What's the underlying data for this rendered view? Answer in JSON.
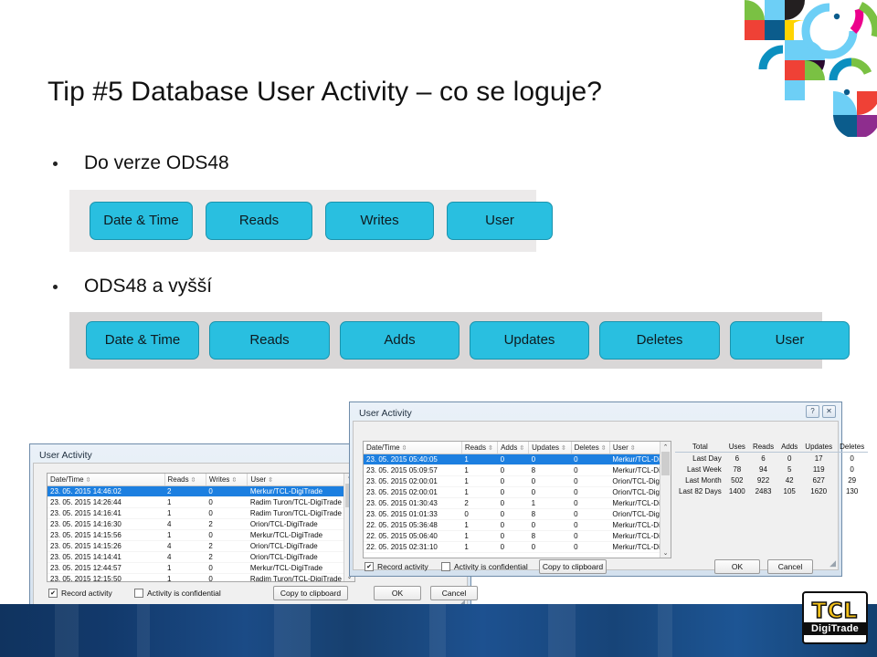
{
  "slide": {
    "title": "Tip #5 Database User Activity – co se loguje?",
    "bullets": [
      {
        "text": "Do verze ODS48"
      },
      {
        "text": "ODS48 a vyšší"
      }
    ]
  },
  "colors": {
    "cyan_button": "#29bfe0",
    "cyan_button_border": "#1a93ad",
    "band_light": "#eceaea",
    "band_dark": "#d9d7d7",
    "selection_blue": "#1c7fe0",
    "footer_blue": "#17406f",
    "logo_yellow": "#f5c21b"
  },
  "band_ods48": {
    "buttons": [
      "Date & Time",
      "Reads",
      "Writes",
      "User"
    ]
  },
  "band_ods48_plus": {
    "buttons": [
      "Date & Time",
      "Reads",
      "Adds",
      "Updates",
      "Deletes",
      "User"
    ]
  },
  "back_window": {
    "title": "User Activity",
    "columns": [
      "Date/Time",
      "Reads",
      "Writes",
      "User"
    ],
    "sort_glyph": "⇳",
    "rows": [
      {
        "datetime": "23. 05. 2015 14:46:02",
        "reads": "2",
        "writes": "0",
        "user": "Merkur/TCL-DigiTrade",
        "selected": true
      },
      {
        "datetime": "23. 05. 2015 14:26:44",
        "reads": "1",
        "writes": "0",
        "user": "Radim Turon/TCL-DigiTrade",
        "selected": false
      },
      {
        "datetime": "23. 05. 2015 14:16:41",
        "reads": "1",
        "writes": "0",
        "user": "Radim Turon/TCL-DigiTrade",
        "selected": false
      },
      {
        "datetime": "23. 05. 2015 14:16:30",
        "reads": "4",
        "writes": "2",
        "user": "Orion/TCL-DigiTrade",
        "selected": false
      },
      {
        "datetime": "23. 05. 2015 14:15:56",
        "reads": "1",
        "writes": "0",
        "user": "Merkur/TCL-DigiTrade",
        "selected": false
      },
      {
        "datetime": "23. 05. 2015 14:15:26",
        "reads": "4",
        "writes": "2",
        "user": "Orion/TCL-DigiTrade",
        "selected": false
      },
      {
        "datetime": "23. 05. 2015 14:14:41",
        "reads": "4",
        "writes": "2",
        "user": "Orion/TCL-DigiTrade",
        "selected": false
      },
      {
        "datetime": "23. 05. 2015 12:44:57",
        "reads": "1",
        "writes": "0",
        "user": "Merkur/TCL-DigiTrade",
        "selected": false
      },
      {
        "datetime": "23. 05. 2015 12:15:50",
        "reads": "1",
        "writes": "0",
        "user": "Radim Turon/TCL-DigiTrade",
        "selected": false
      }
    ],
    "footer": {
      "record_activity_label": "Record activity",
      "record_activity_checked": true,
      "record_activity_mark": "✔",
      "confidential_label": "Activity is confidential",
      "confidential_checked": false,
      "copy_label": "Copy to clipboard",
      "ok_label": "OK",
      "cancel_label": "Cancel"
    },
    "scroll_up_glyph": "⌃",
    "scroll_down_glyph": "⌄"
  },
  "front_window": {
    "title": "User Activity",
    "caption_help": "?",
    "caption_close": "✕",
    "columns": [
      "Date/Time",
      "Reads",
      "Adds",
      "Updates",
      "Deletes",
      "User"
    ],
    "sort_glyph": "⇳",
    "rows": [
      {
        "datetime": "23. 05. 2015 05:40:05",
        "reads": "1",
        "adds": "0",
        "updates": "0",
        "deletes": "0",
        "user": "Merkur/TCL-DigiTrade",
        "selected": true
      },
      {
        "datetime": "23. 05. 2015 05:09:57",
        "reads": "1",
        "adds": "0",
        "updates": "8",
        "deletes": "0",
        "user": "Merkur/TCL-DigiTrade",
        "selected": false
      },
      {
        "datetime": "23. 05. 2015 02:00:01",
        "reads": "1",
        "adds": "0",
        "updates": "0",
        "deletes": "0",
        "user": "Orion/TCL-DigiTrade",
        "selected": false
      },
      {
        "datetime": "23. 05. 2015 02:00:01",
        "reads": "1",
        "adds": "0",
        "updates": "0",
        "deletes": "0",
        "user": "Orion/TCL-DigiTrade",
        "selected": false
      },
      {
        "datetime": "23. 05. 2015 01:30:43",
        "reads": "2",
        "adds": "0",
        "updates": "1",
        "deletes": "0",
        "user": "Merkur/TCL-DigiTrade",
        "selected": false
      },
      {
        "datetime": "23. 05. 2015 01:01:33",
        "reads": "0",
        "adds": "0",
        "updates": "8",
        "deletes": "0",
        "user": "Orion/TCL-DigiTrade",
        "selected": false
      },
      {
        "datetime": "22. 05. 2015 05:36:48",
        "reads": "1",
        "adds": "0",
        "updates": "0",
        "deletes": "0",
        "user": "Merkur/TCL-DigiTrade",
        "selected": false
      },
      {
        "datetime": "22. 05. 2015 05:06:40",
        "reads": "1",
        "adds": "0",
        "updates": "8",
        "deletes": "0",
        "user": "Merkur/TCL-DigiTrade",
        "selected": false
      },
      {
        "datetime": "22. 05. 2015 02:31:10",
        "reads": "1",
        "adds": "0",
        "updates": "0",
        "deletes": "0",
        "user": "Merkur/TCL-DigiTrade",
        "selected": false
      }
    ],
    "summary": {
      "columns": [
        "Total",
        "Uses",
        "Reads",
        "Adds",
        "Updates",
        "Deletes"
      ],
      "rows": [
        {
          "label": "Last Day",
          "uses": "6",
          "reads": "6",
          "adds": "0",
          "updates": "17",
          "deletes": "0"
        },
        {
          "label": "Last Week",
          "uses": "78",
          "reads": "94",
          "adds": "5",
          "updates": "119",
          "deletes": "0"
        },
        {
          "label": "Last Month",
          "uses": "502",
          "reads": "922",
          "adds": "42",
          "updates": "627",
          "deletes": "29"
        },
        {
          "label": "Last 82 Days",
          "uses": "1400",
          "reads": "2483",
          "adds": "105",
          "updates": "1620",
          "deletes": "130"
        }
      ]
    },
    "footer": {
      "record_activity_label": "Record activity",
      "record_activity_checked": true,
      "record_activity_mark": "✔",
      "confidential_label": "Activity is confidential",
      "confidential_checked": false,
      "copy_label": "Copy to clipboard",
      "ok_label": "OK",
      "cancel_label": "Cancel"
    },
    "scroll_up_glyph": "⌃",
    "scroll_down_glyph": "⌄"
  },
  "logo": {
    "mark": "TCL",
    "word": "DigiTrade"
  }
}
